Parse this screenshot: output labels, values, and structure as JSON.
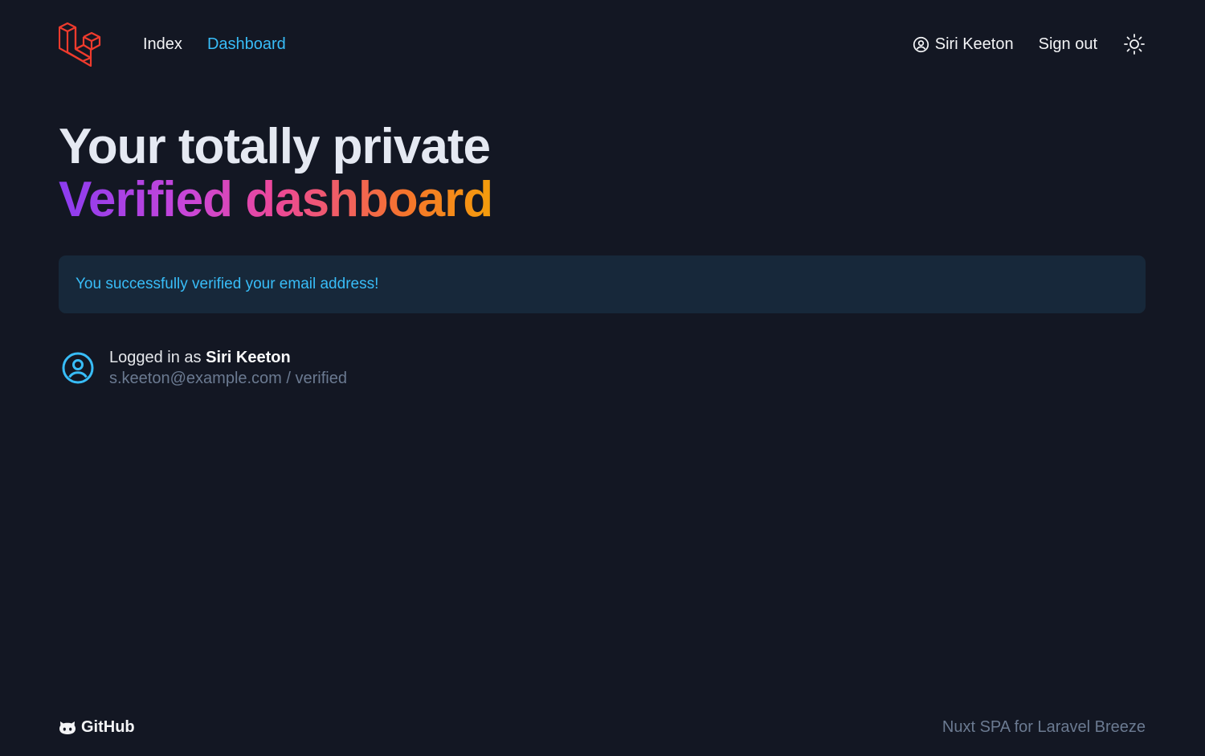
{
  "header": {
    "logo_icon": "laravel-logo-icon",
    "nav": [
      {
        "label": "Index",
        "active": false
      },
      {
        "label": "Dashboard",
        "active": true
      }
    ],
    "user_icon": "user-circle-icon",
    "user_name": "Siri Keeton",
    "signout_label": "Sign out",
    "theme_icon": "sun-icon"
  },
  "hero": {
    "line1": "Your totally private",
    "line2": "Verified dashboard"
  },
  "alert": {
    "message": "You successfully verified your email address!"
  },
  "userinfo": {
    "avatar_icon": "user-circle-icon",
    "prefix": "Logged in as ",
    "name": "Siri Keeton",
    "email": "s.keeton@example.com",
    "separator": " / ",
    "status": "verified"
  },
  "footer": {
    "github_icon": "github-icon",
    "github_label": "GitHub",
    "note": "Nuxt SPA for Laravel Breeze"
  },
  "colors": {
    "background": "#131723",
    "accent": "#38bdf8",
    "laravel_red": "#ef3b2d",
    "alert_bg": "#17283a",
    "muted": "#6b7a91"
  }
}
